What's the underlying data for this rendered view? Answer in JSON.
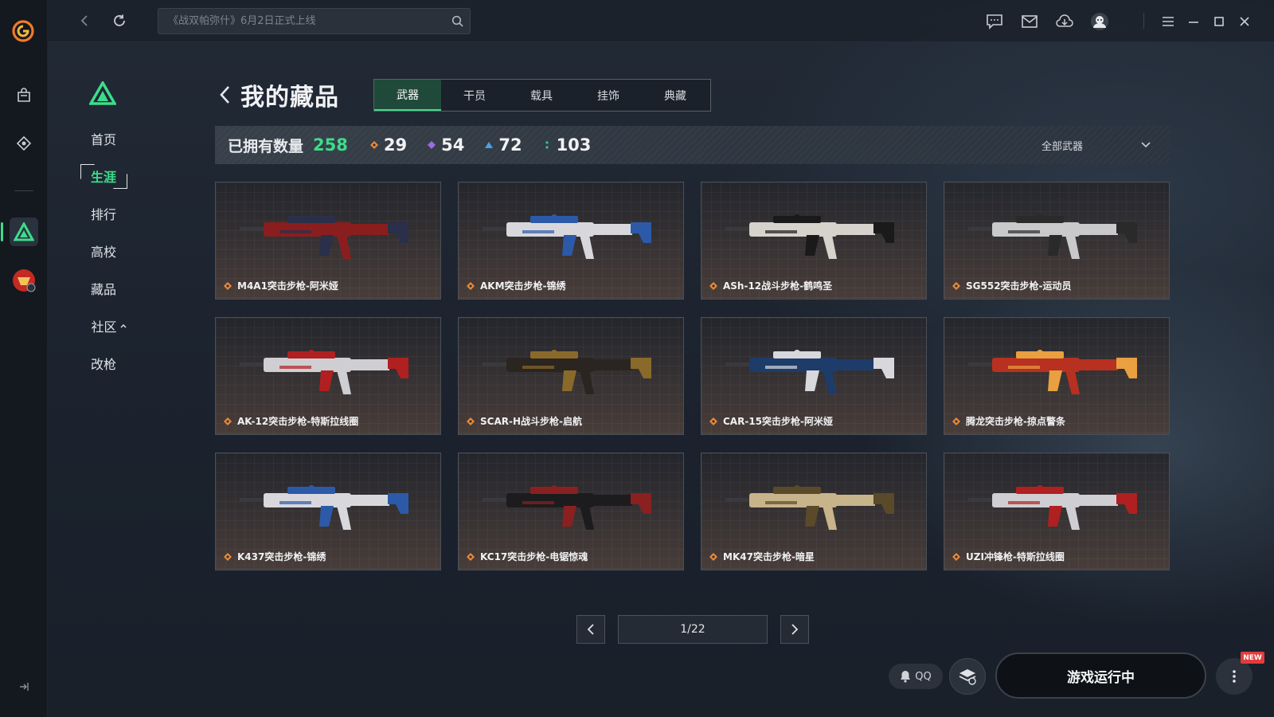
{
  "colors": {
    "accent": "#3ddc8a",
    "gold": "#e8893a",
    "purple": "#9b6bdf",
    "blue": "#4aa0e6",
    "teal": "#2ec4a4"
  },
  "topbar": {
    "search_placeholder": "《战双帕弥什》6月2日正式上线",
    "icons": [
      "chat-icon",
      "mail-icon",
      "download-icon",
      "avatar-icon",
      "menu-icon",
      "minimize-icon",
      "maximize-icon",
      "close-icon"
    ]
  },
  "rail": {
    "icons": [
      "app-logo",
      "bag-icon",
      "tag-icon",
      "game-logo-active",
      "cf-game-icon"
    ]
  },
  "sidebar": {
    "items": [
      {
        "label": "首页"
      },
      {
        "label": "生涯",
        "active": true
      },
      {
        "label": "排行"
      },
      {
        "label": "高校"
      },
      {
        "label": "藏品"
      },
      {
        "label": "社区"
      },
      {
        "label": "改枪"
      }
    ]
  },
  "page": {
    "title": "我的藏品"
  },
  "tabs": [
    {
      "label": "武器",
      "active": true
    },
    {
      "label": "干员"
    },
    {
      "label": "载具"
    },
    {
      "label": "挂饰"
    },
    {
      "label": "典藏"
    }
  ],
  "stats": {
    "owned_label": "已拥有数量",
    "owned_value": "258",
    "rarities": [
      {
        "color": "#e8893a",
        "value": "29"
      },
      {
        "color": "#9b6bdf",
        "value": "54"
      },
      {
        "color": "#4aa0e6",
        "value": "72"
      },
      {
        "color": "#2ec4a4",
        "value": "103"
      }
    ],
    "filter_label": "全部武器"
  },
  "items": [
    {
      "name": "M4A1突击步枪-阿米娅",
      "body": "#8a1e1e",
      "accent": "#2a2f4a"
    },
    {
      "name": "AKM突击步枪-锦绣",
      "body": "#d8d8dc",
      "accent": "#2c5aa8"
    },
    {
      "name": "ASh-12战斗步枪-鹤鸣圣",
      "body": "#d6d2cc",
      "accent": "#1a1a1a"
    },
    {
      "name": "SG552突击步枪-运动员",
      "body": "#c9c9cc",
      "accent": "#2a2a2a"
    },
    {
      "name": "AK-12突击步枪-特斯拉线圈",
      "body": "#cfcfd3",
      "accent": "#b02020"
    },
    {
      "name": "SCAR-H战斗步枪-启航",
      "body": "#2a2520",
      "accent": "#8a6a2a"
    },
    {
      "name": "CAR-15突击步枪-阿米娅",
      "body": "#1d3c6a",
      "accent": "#d8d8dc"
    },
    {
      "name": "腾龙突击步枪-掠点警条",
      "body": "#b83020",
      "accent": "#e8a040"
    },
    {
      "name": "K437突击步枪-锦绣",
      "body": "#d8d8dc",
      "accent": "#2c5aa8"
    },
    {
      "name": "KC17突击步枪-电锯惊魂",
      "body": "#1c1c1e",
      "accent": "#8a2020"
    },
    {
      "name": "MK47突击步枪-暗星",
      "body": "#c8b48a",
      "accent": "#5a4a2a"
    },
    {
      "name": "UZI冲锋枪-特斯拉线圈",
      "body": "#cfcfd3",
      "accent": "#b02020"
    }
  ],
  "pager": {
    "text": "1/22"
  },
  "footer": {
    "qq_label": "QQ",
    "launch_label": "游戏运行中",
    "new_badge": "NEW"
  }
}
